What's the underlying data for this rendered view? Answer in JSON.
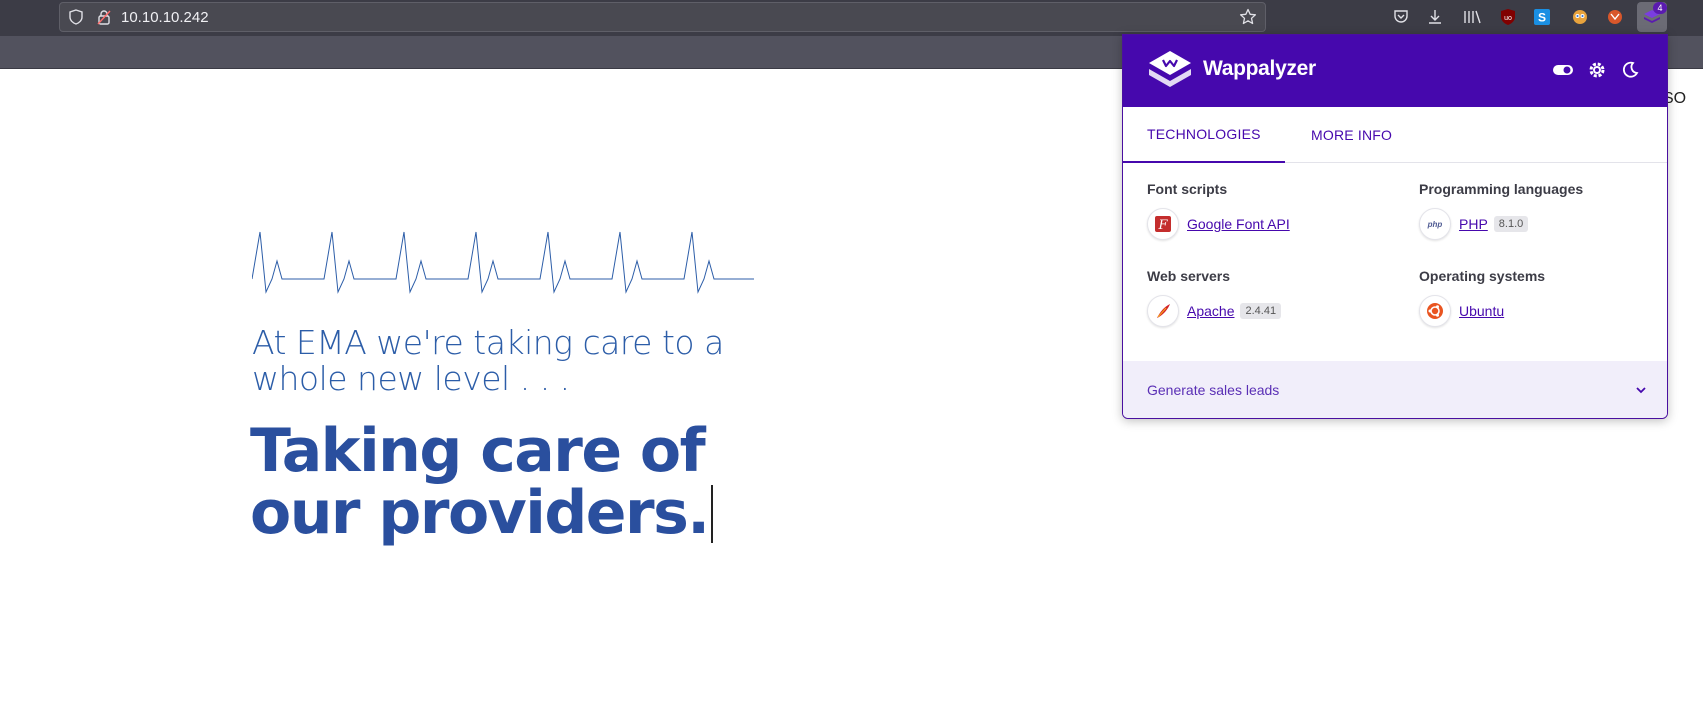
{
  "browser": {
    "url": "10.10.10.242",
    "extension_badge_count": "4"
  },
  "page": {
    "tagline": "At EMA we're taking care to a whole new level . . .",
    "headline_line1": "Taking care of",
    "headline_line2": "our providers.",
    "nav_peek": "SO",
    "colors": {
      "tagline": "#2c5da8",
      "headline": "#2a4f9e"
    }
  },
  "wappalyzer": {
    "title": "Wappalyzer",
    "tabs": [
      "TECHNOLOGIES",
      "MORE INFO"
    ],
    "active_tab": "TECHNOLOGIES",
    "categories": [
      {
        "name": "Font scripts",
        "items": [
          {
            "name": "Google Font API",
            "version": "",
            "icon": "google-font-api-icon"
          }
        ]
      },
      {
        "name": "Programming languages",
        "items": [
          {
            "name": "PHP",
            "version": "8.1.0",
            "icon": "php-icon"
          }
        ]
      },
      {
        "name": "Web servers",
        "items": [
          {
            "name": "Apache",
            "version": "2.4.41",
            "icon": "apache-feather-icon"
          }
        ]
      },
      {
        "name": "Operating systems",
        "items": [
          {
            "name": "Ubuntu",
            "version": "",
            "icon": "ubuntu-icon"
          }
        ]
      }
    ],
    "footer": "Generate sales leads",
    "colors": {
      "brand": "#4608ad",
      "footer_bg": "#f1eefa"
    }
  }
}
